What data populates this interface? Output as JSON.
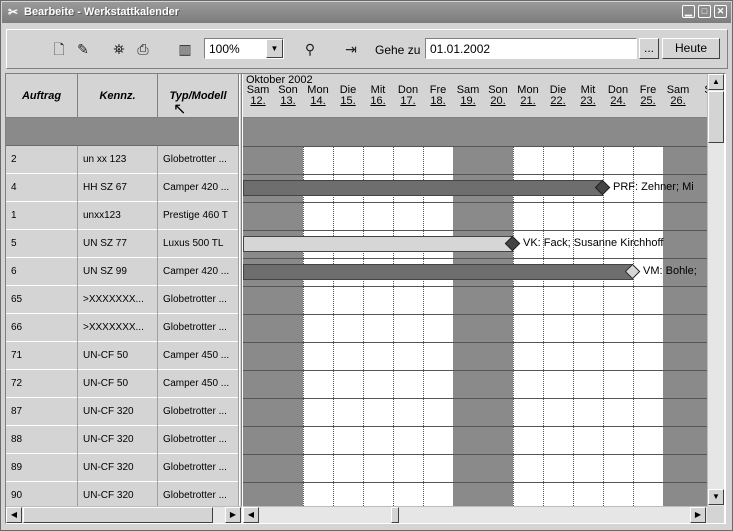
{
  "window": {
    "title": "Bearbeite - Werkstattkalender",
    "app_icon": "calendar-app-icon",
    "buttons": [
      "minimize-icon",
      "maximize-icon",
      "close-icon"
    ]
  },
  "toolbar": {
    "icons": [
      "new-document-icon",
      "edit-icon",
      "binoculars-icon",
      "print-icon",
      "columns-icon"
    ],
    "zoom_value": "100%",
    "filter_icon": "filter-icon",
    "exit_icon": "exit-door-icon",
    "goto_label": "Gehe zu",
    "goto_value": "01.01.2002",
    "browse_label": "...",
    "today_label": "Heute"
  },
  "grid": {
    "columns": [
      "Auftrag",
      "Kennz.",
      "Typ/Modell"
    ],
    "rows": [
      {
        "auftrag": "2",
        "kennz": "un xx 123",
        "typ": "Globetrotter ..."
      },
      {
        "auftrag": "4",
        "kennz": "HH SZ 67",
        "typ": "Camper 420 ..."
      },
      {
        "auftrag": "1",
        "kennz": "unxx123",
        "typ": "Prestige 460 T"
      },
      {
        "auftrag": "5",
        "kennz": "UN SZ 77",
        "typ": "Luxus 500 TL"
      },
      {
        "auftrag": "6",
        "kennz": "UN SZ 99",
        "typ": "Camper 420 ..."
      },
      {
        "auftrag": "65",
        "kennz": ">XXXXXXX...",
        "typ": "Globetrotter ..."
      },
      {
        "auftrag": "66",
        "kennz": ">XXXXXXX...",
        "typ": "Globetrotter ..."
      },
      {
        "auftrag": "71",
        "kennz": "UN-CF 50",
        "typ": "Camper 450 ..."
      },
      {
        "auftrag": "72",
        "kennz": "UN-CF 50",
        "typ": "Camper 450 ..."
      },
      {
        "auftrag": "87",
        "kennz": "UN-CF 320",
        "typ": "Globetrotter ..."
      },
      {
        "auftrag": "88",
        "kennz": "UN-CF 320",
        "typ": "Globetrotter ..."
      },
      {
        "auftrag": "89",
        "kennz": "UN-CF 320",
        "typ": "Globetrotter ..."
      },
      {
        "auftrag": "90",
        "kennz": "UN-CF 320",
        "typ": "Globetrotter ..."
      }
    ]
  },
  "calendar": {
    "month": "Oktober 2002",
    "days": [
      {
        "name": "Sam",
        "date": "12.",
        "weekend": true
      },
      {
        "name": "Son",
        "date": "13.",
        "weekend": true
      },
      {
        "name": "Mon",
        "date": "14.",
        "weekend": false
      },
      {
        "name": "Die",
        "date": "15.",
        "weekend": false
      },
      {
        "name": "Mit",
        "date": "16.",
        "weekend": false
      },
      {
        "name": "Don",
        "date": "17.",
        "weekend": false
      },
      {
        "name": "Fre",
        "date": "18.",
        "weekend": false
      },
      {
        "name": "Sam",
        "date": "19.",
        "weekend": true
      },
      {
        "name": "Son",
        "date": "20.",
        "weekend": true
      },
      {
        "name": "Mon",
        "date": "21.",
        "weekend": false
      },
      {
        "name": "Die",
        "date": "22.",
        "weekend": false
      },
      {
        "name": "Mit",
        "date": "23.",
        "weekend": false
      },
      {
        "name": "Don",
        "date": "24.",
        "weekend": false
      },
      {
        "name": "Fre",
        "date": "25.",
        "weekend": false
      },
      {
        "name": "Sam",
        "date": "26.",
        "weekend": true
      },
      {
        "name": "S",
        "date": "",
        "weekend": true
      }
    ],
    "bars": [
      {
        "row": 1,
        "start_day": 0,
        "end_day": 12.0,
        "color": "#6e6e6e",
        "marker_color": "#444444",
        "label": "PRF: Zehner; Mi"
      },
      {
        "row": 3,
        "start_day": 0,
        "end_day": 9.0,
        "color": "#d6d6d6",
        "marker_color": "#444444",
        "label": "VK: Fack; Susanne Kirchhoff"
      },
      {
        "row": 4,
        "start_day": 0,
        "end_day": 13.0,
        "color": "#6e6e6e",
        "marker_color": "#d6d6d6",
        "label": "VM: Bohle;"
      }
    ]
  },
  "colors": {
    "weekend": "#8a8a8a",
    "face": "#d4d4d4"
  }
}
